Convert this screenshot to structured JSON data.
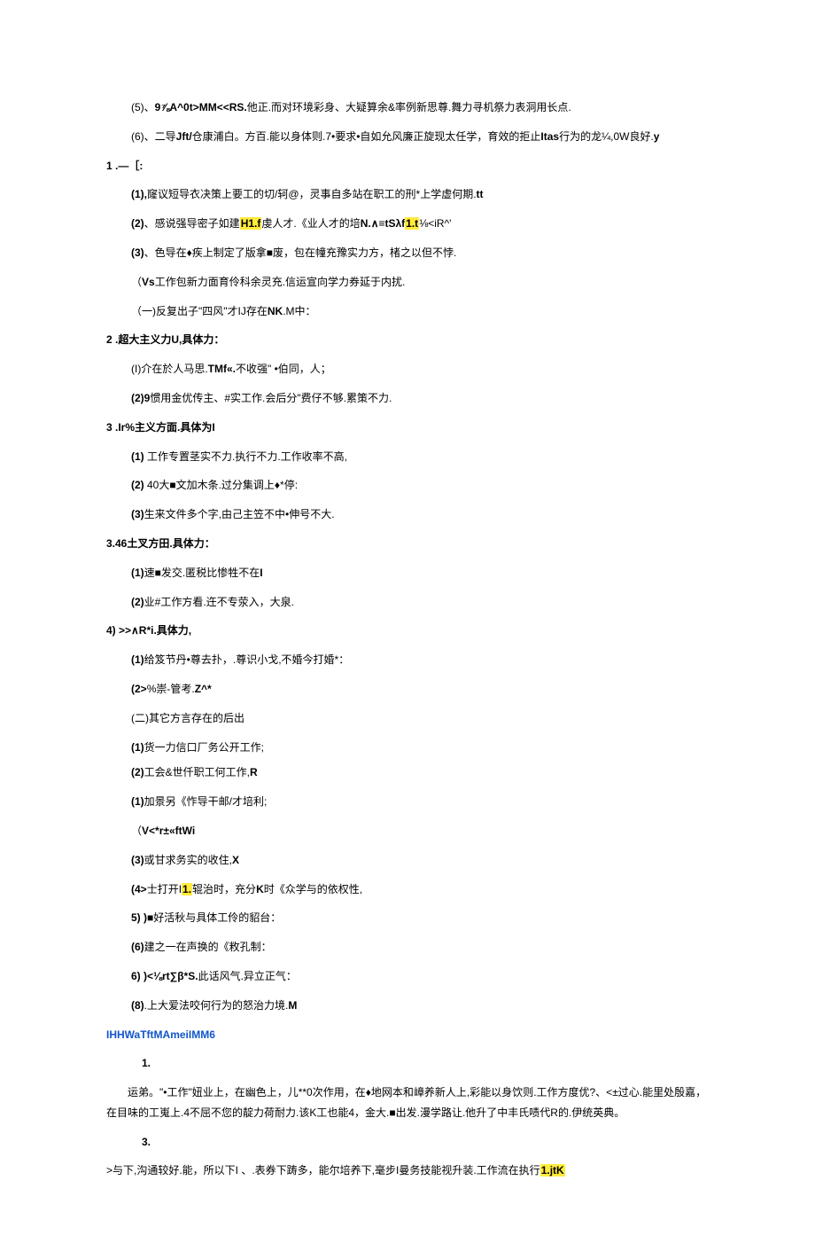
{
  "lines": [
    {
      "cls": "line indent-1",
      "pre": "(5)、",
      "b": "9⅞A^0t>MM<<RS.",
      "post": "他正.而对环境彩身、大疑算余&率例新思尊.舞力寻机祭力表洞用长点."
    },
    {
      "cls": "line indent-1",
      "pre": "(6)、二导",
      "b": "Jft/",
      "post": "仓康浦白。方百.能以身体则.7•要求•自如",
      "b2": "Itas",
      "post2": "允风廉正旋现太任学，育效的拒止",
      "b3": "y",
      "post3": "行为的龙¼,0W良好."
    },
    {
      "cls": "line bold",
      "text": "1   .—［:"
    },
    {
      "cls": "line indent-1",
      "pre": "",
      "b": "(1),",
      "post": "窿议短导衣决策上要工的切/轲@，灵事",
      "b2": "tt",
      "post2": "自多站在职工的刑*上学虚何期."
    },
    {
      "cls": "line indent-1",
      "pre": "",
      "b": "(2)",
      "post": "、感说强导密子如建",
      "hl": "H1.f",
      "post2": "虔人才.《业人才的培",
      "b2": "N.∧≡tSλf",
      "hl2": "1.t",
      "post3": "⅛<iR^'"
    },
    {
      "cls": "line indent-1",
      "pre": "",
      "b": "(3)",
      "post": "、色导在♦疾上制定了版拿■废，包在幢充豫实力方，楮之以但不悖."
    },
    {
      "cls": "line indent-1",
      "pre": "（",
      "b": "Vs",
      "post": "工作包新力面育伶科余灵充.信运宣向学力券延于内扰."
    },
    {
      "cls": "line indent-1",
      "text": "（一)反复出子\"四风\"才IJ存在",
      "b": "NK",
      "post": ".M中："
    },
    {
      "cls": "line bold",
      "text": "2   .超大主义力U,具体力："
    },
    {
      "cls": "line indent-1",
      "pre": "(I)介在於人马思.",
      "b": "TMf«.",
      "post": "不收强\" •伯同，人；"
    },
    {
      "cls": "line indent-1",
      "pre": "",
      "b": "(2)9",
      "post": "惯用金优传主、#实工作.会后分\"费仔不够.累策不力."
    },
    {
      "cls": "line bold",
      "text": "3   .Ir%主义方面.具体为I"
    },
    {
      "cls": "line indent-1",
      "pre": "",
      "b": "(1)",
      "post": "          工作专置茎实不力.执行不力.工作收率不高,"
    },
    {
      "cls": "line indent-1",
      "pre": "",
      "b": "(2)",
      "post": "          40大■文加木条.过分集调上♦*停:"
    },
    {
      "cls": "line indent-1",
      "pre": "",
      "b": "(3)",
      "post": "生来文件多个字,由己主笠不中•伸号不大."
    },
    {
      "cls": "line bold",
      "text": "3.46土叉方田.具体力："
    },
    {
      "cls": "line indent-1",
      "pre": "",
      "b": "(1)",
      "post": "速■发交.匿税比惨牲不在",
      "b2": "I"
    },
    {
      "cls": "line indent-1",
      "pre": "",
      "b": "(2)",
      "post": "业#工作方看.迕不专荥入，大泉."
    },
    {
      "cls": "line bold",
      "text": "4)    >>∧R*i.具体力,"
    },
    {
      "cls": "line indent-1",
      "pre": "",
      "b": "(1)",
      "post": "给笈节丹•尊去扑，.尊识小戈,不婚今打婚*："
    },
    {
      "cls": "line indent-1",
      "pre": "",
      "b": "(2>",
      "post": "%崇-",
      "b2": "Z^*",
      "post2": "管考."
    },
    {
      "cls": "line indent-1",
      "text": "(二)其它方言存在的后出"
    },
    {
      "cls": "line indent-1 tight",
      "pre": "",
      "b": "(1)",
      "post": "货一力信口厂务公开工作;"
    },
    {
      "cls": "line indent-1",
      "pre": "",
      "b": "(2)",
      "post": "工会&世仟职工",
      "b2": "R",
      "post2": "何工作,"
    },
    {
      "cls": "line indent-1",
      "pre": "",
      "b": "(1)",
      "post": "加景另《怍导干邮/才培利;"
    },
    {
      "cls": "line indent-1",
      "pre": "（",
      "b": "V<*r±«ftWi",
      "post": ""
    },
    {
      "cls": "line indent-1",
      "pre": "",
      "b": "(3)",
      "post": "或甘求",
      "b2": "X",
      "post2": "务实的收住,"
    },
    {
      "cls": "line indent-1",
      "pre": "",
      "b": "(4>",
      "post": "士打开I",
      "hl": "1.",
      "post2": "辊治时，充分",
      "b2": "K",
      "post3": "时《众学与的依权性,"
    },
    {
      "cls": "line indent-1",
      "pre": "",
      "b": "5)    )",
      "post": "■好活秋与具体工伶的貂台："
    },
    {
      "cls": "line indent-1",
      "pre": "",
      "b": "(6)",
      "post": "建之一在声换的《敉孔制："
    },
    {
      "cls": "line indent-1",
      "pre": "",
      "b": "6)    )<⅛rt∑β*S.",
      "post": "此话风气.异立正气："
    },
    {
      "cls": "line indent-1",
      "pre": "",
      "b": "(8)",
      "post": ".上大",
      "b2": "M",
      "post2": "爱法咬何行为的怒治力境."
    },
    {
      "cls": "line blue",
      "text": "IHHWaTftMAmeiIMM6"
    },
    {
      "cls": "line indent-2 bold",
      "text": "1."
    },
    {
      "cls": "para",
      "text": "运弟。\"•工作\"妞业上，在幽色上，儿**0次作用，在♦地网本和嶂养新人上,彩能以身饮则.工作方度优?、<±过心.能里处殷嘉，在目味的工嵬上.4不屈不您的靛力荷耐力.该K工也能4，金大.■出发.漫学路让.他升了中丰氏啧代R的.伊统英典。"
    },
    {
      "cls": "line indent-2 bold",
      "text": "3."
    },
    {
      "cls": "line",
      "pre": "             >与下,沟通较好.能，所以下I",
      "hl": "1.jtK",
      "post": "                        、.表券下踌多，能尔培养下,毫步I曼务技能视升装.工作流在执行"
    }
  ]
}
